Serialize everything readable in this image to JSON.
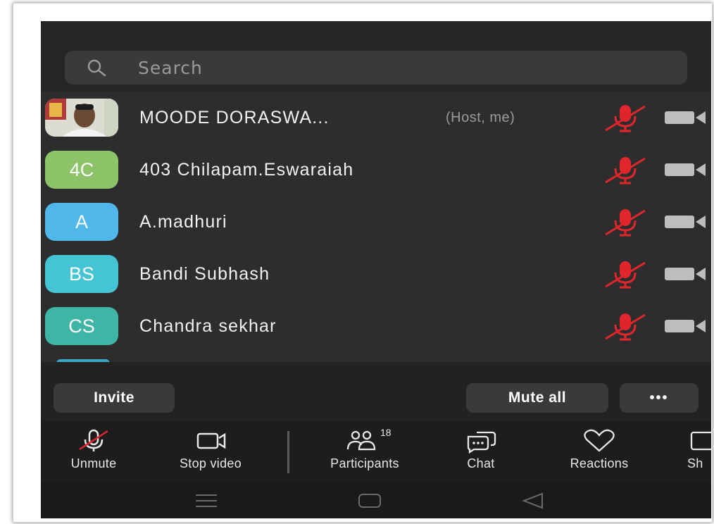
{
  "search": {
    "placeholder": "Search"
  },
  "participants": [
    {
      "name": "MOODE DORASWA...",
      "role": "(Host, me)",
      "avatar_text": "",
      "avatar_color": "#cccccc",
      "has_photo": true
    },
    {
      "name": "403 Chilapam.Eswaraiah",
      "role": "",
      "avatar_text": "4C",
      "avatar_color": "#8dc46a"
    },
    {
      "name": "A.madhuri",
      "role": "",
      "avatar_text": "A",
      "avatar_color": "#4fb7ea"
    },
    {
      "name": "Bandi Subhash",
      "role": "",
      "avatar_text": "BS",
      "avatar_color": "#45c4d3"
    },
    {
      "name": "Chandra sekhar",
      "role": "",
      "avatar_text": "CS",
      "avatar_color": "#3fb5a6"
    }
  ],
  "actions": {
    "invite": "Invite",
    "mute_all": "Mute all",
    "more": "•••"
  },
  "toolbar": {
    "unmute": "Unmute",
    "stop_video": "Stop video",
    "participants": "Participants",
    "participants_count": "18",
    "chat": "Chat",
    "reactions": "Reactions",
    "share": "Sh"
  },
  "colors": {
    "muted_mic": "#e0262c",
    "camera": "#bdbdbd"
  }
}
